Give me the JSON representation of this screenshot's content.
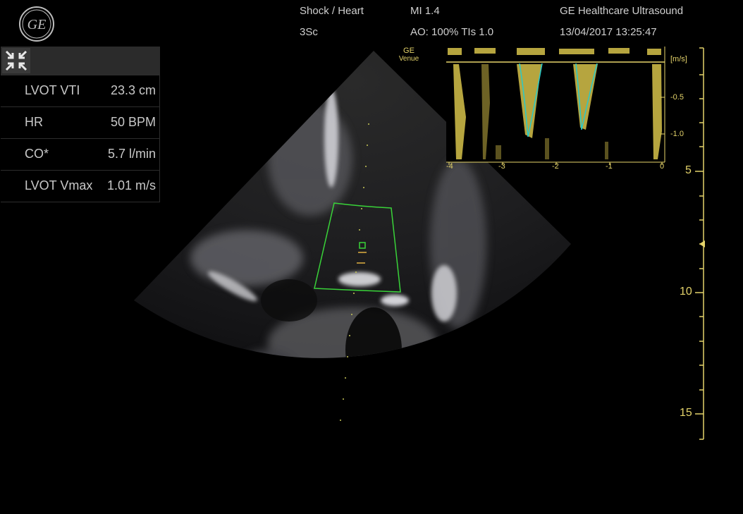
{
  "header": {
    "preset": "Shock / Heart",
    "probe": "3Sc",
    "mi": "MI 1.4",
    "ao_tis": "AO: 100% TIs 1.0",
    "vendor": "GE Healthcare Ultrasound",
    "datetime": "13/04/2017 13:25:47"
  },
  "logo": {
    "text": "GE"
  },
  "measurements": [
    {
      "label": "LVOT VTI",
      "value": "23.3 cm"
    },
    {
      "label": "HR",
      "value": "50 BPM"
    },
    {
      "label": "CO*",
      "value": "5.7 l/min"
    },
    {
      "label": "LVOT Vmax",
      "value": "1.01 m/s"
    }
  ],
  "probe_marker": {
    "brand": "GE",
    "model": "Venue"
  },
  "doppler": {
    "unit": "[m/s]",
    "y_ticks": [
      "-0.5",
      "-1.0"
    ],
    "x_ticks": [
      "-4",
      "-3",
      "-2",
      "-1",
      "0"
    ]
  },
  "depth_scale": {
    "labels": [
      "5",
      "10",
      "15"
    ]
  },
  "colors": {
    "yellow": "#e4d36a",
    "roi_green": "#39d339",
    "trace_cyan": "#29c9c9"
  }
}
